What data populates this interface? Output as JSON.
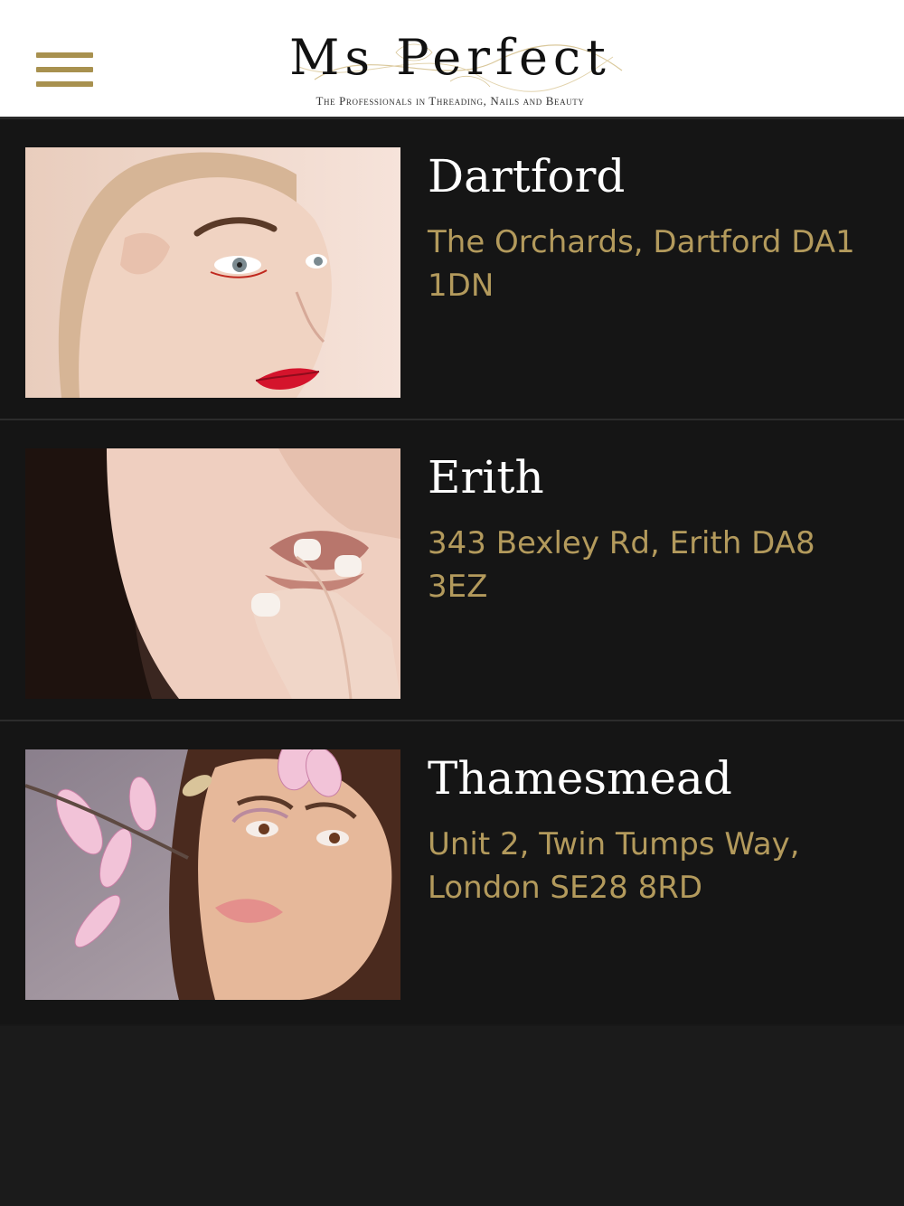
{
  "header": {
    "menu_icon": "hamburger-menu-icon",
    "logo": {
      "title": "Ms Perfect",
      "tagline": "The Professionals in Threading, Nails and Beauty"
    }
  },
  "colors": {
    "accent_gold": "#b39a5c",
    "menu_gold": "#a8914f",
    "background": "#151515",
    "header_bg": "#ffffff",
    "name_text": "#ffffff"
  },
  "locations": [
    {
      "name": "Dartford",
      "address": "The Orchards, Dartford DA1 1DN"
    },
    {
      "name": "Erith",
      "address": "343 Bexley Rd, Erith DA8 3EZ"
    },
    {
      "name": "Thamesmead",
      "address": "Unit 2, Twin Tumps Way, London SE28 8RD"
    }
  ]
}
